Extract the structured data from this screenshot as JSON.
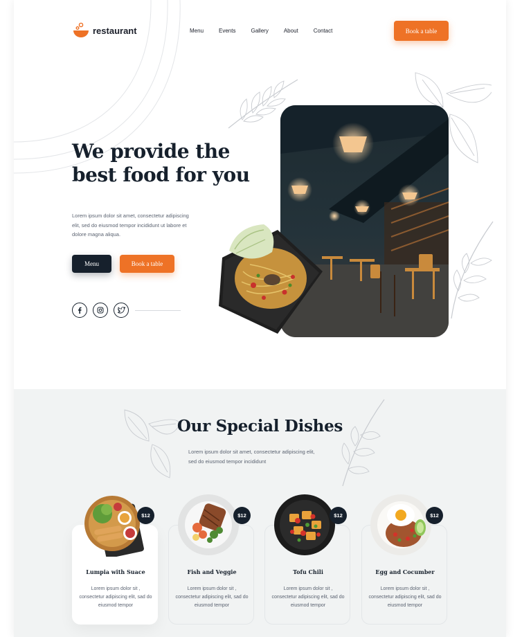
{
  "brand": {
    "name": "restaurant",
    "accent": "#ee7226",
    "dark": "#16202c"
  },
  "nav": {
    "links": [
      "Menu",
      "Events",
      "Gallery",
      "About",
      "Contact"
    ],
    "cta": "Book a table"
  },
  "hero": {
    "title": "We provide the best food for you",
    "text": "Lorem ipsum dolor sit amet, consectetur adipiscing elit, sed do eiusmod tempor incididunt ut labore et dolore magna aliqua.",
    "menu_button": "Menu",
    "book_button": "Book a table",
    "socials": [
      "facebook-icon",
      "instagram-icon",
      "twitter-icon"
    ]
  },
  "special": {
    "title": "Our Special Dishes",
    "subtitle": "Lorem ipsum dolor sit amet, consectetur adipiscing elit, sed do eiusmod tempor incididunt",
    "dishes": [
      {
        "name": "Lumpia with Suace",
        "price": "$12",
        "desc": "Lorem ipsum dolor sit , consectetur adipiscing elit, sad do eiusmod tempor"
      },
      {
        "name": "Fish and Veggie",
        "price": "$12",
        "desc": "Lorem ipsum dolor sit , consectetur adipiscing elit, sad do eiusmod tempor"
      },
      {
        "name": "Tofu Chili",
        "price": "$12",
        "desc": "Lorem ipsum dolor sit , consectetur adipiscing elit, sad do eiusmod tempor"
      },
      {
        "name": "Egg and Cocumber",
        "price": "$12",
        "desc": "Lorem ipsum dolor sit , consectetur adipiscing elit, sad do eiusmod tempor"
      }
    ]
  }
}
